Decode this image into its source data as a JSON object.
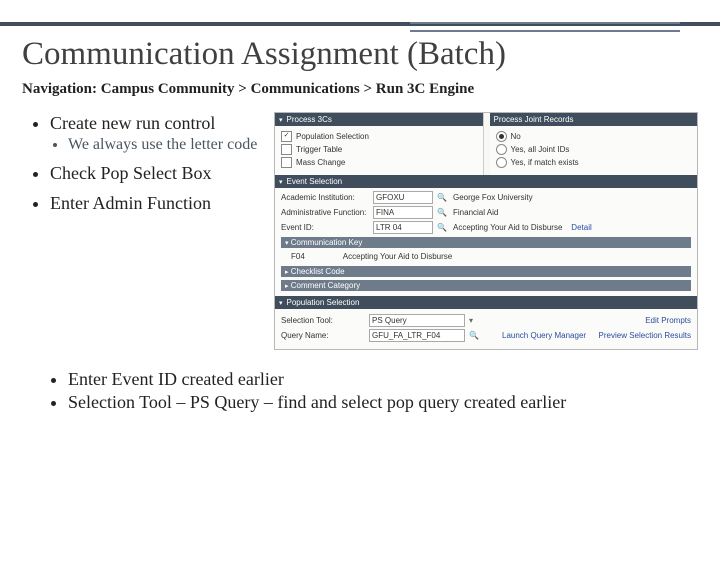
{
  "title": "Communication Assignment (Batch)",
  "nav": "Navigation: Campus Community > Communications > Run 3C Engine",
  "left_bullets": {
    "b1": "Create new run control",
    "b1_sub": "We always use the letter code",
    "b2": "Check Pop Select Box",
    "b3": "Enter Admin Function"
  },
  "lower_bullets": {
    "l1": "Enter Event ID created earlier",
    "l2": "Selection Tool – PS Query – find and select pop query created earlier"
  },
  "shot": {
    "section_process": "Process 3Cs",
    "chk_pop": {
      "label": "Population Selection",
      "checked": true
    },
    "chk_trigger": {
      "label": "Trigger Table",
      "checked": false
    },
    "chk_mass": {
      "label": "Mass Change",
      "checked": false
    },
    "section_joint": "Process Joint Records",
    "radio_no": "No",
    "radio_yes_all": "Yes, all Joint IDs",
    "radio_yes_if": "Yes, if match exists",
    "section_event": "Event Selection",
    "fields": {
      "inst_lbl": "Academic Institution:",
      "inst_val": "GFOXU",
      "inst_desc": "George Fox University",
      "func_lbl": "Administrative Function:",
      "func_val": "FINA",
      "func_desc": "Financial Aid",
      "event_lbl": "Event ID:",
      "event_val": "LTR 04",
      "event_desc": "Accepting Your Aid to Disburse",
      "detail": "Detail"
    },
    "sub_comm_key": "Communication Key",
    "comm_key_code": "F04",
    "comm_key_desc": "Accepting Your Aid to Disburse",
    "sub_checklist": "Checklist Code",
    "sub_comment": "Comment Category",
    "section_popsel": "Population Selection",
    "sel_tool_lbl": "Selection Tool:",
    "sel_tool_val": "PS Query",
    "edit_prompts": "Edit Prompts",
    "query_lbl": "Query Name:",
    "query_val": "GFU_FA_LTR_F04",
    "launch": "Launch Query Manager",
    "preview": "Preview Selection Results"
  }
}
